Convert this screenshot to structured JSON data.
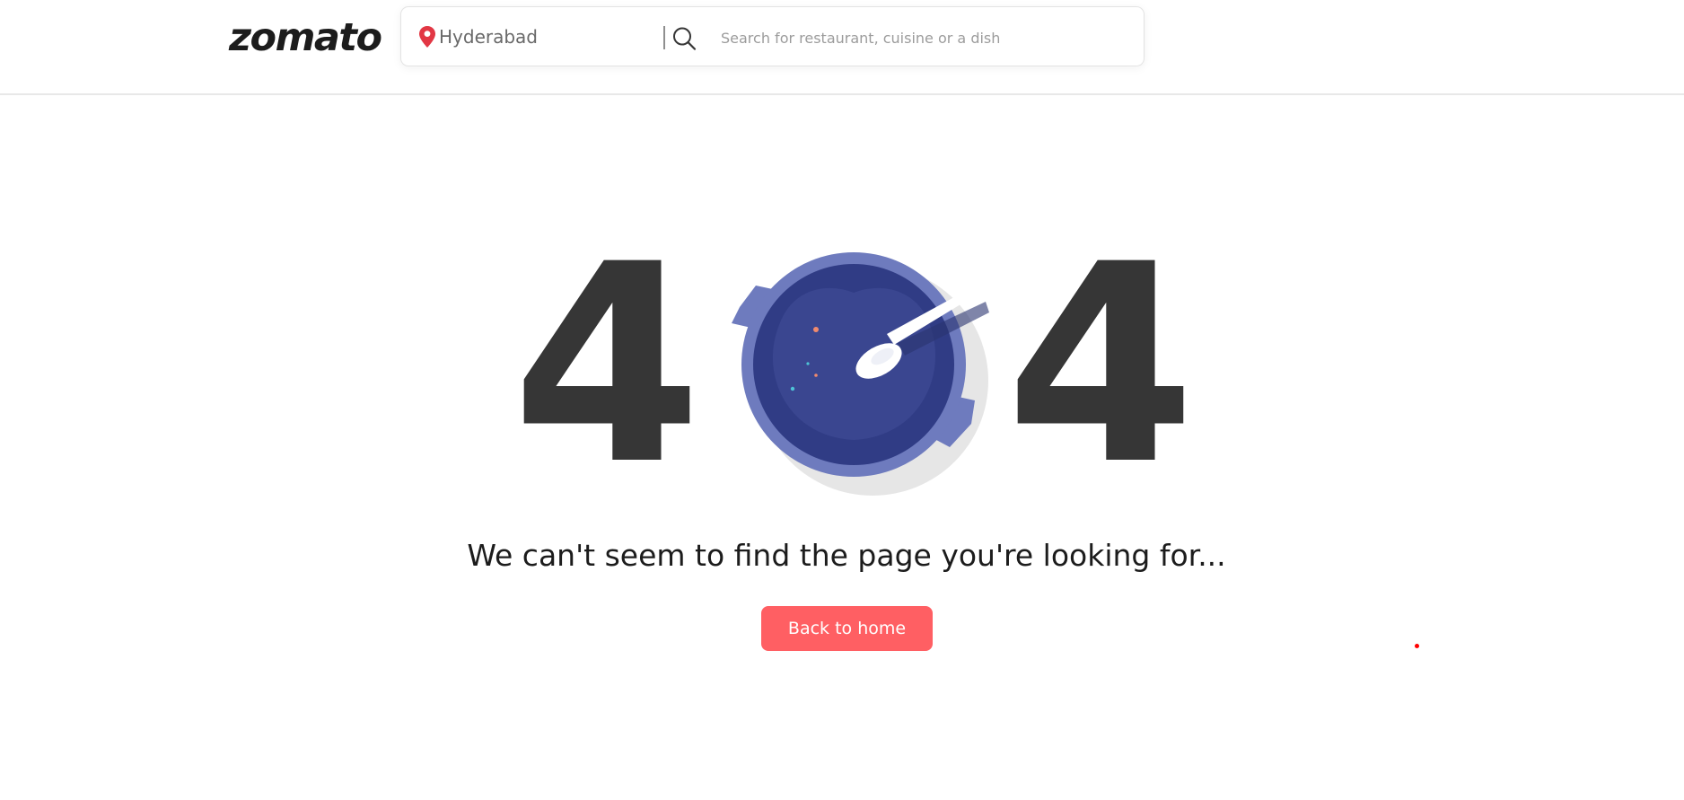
{
  "header": {
    "logo_text": "zomato",
    "search": {
      "location_value": "Hyderabad",
      "location_icon": "location-pin-icon",
      "search_icon": "search-icon",
      "placeholder": "Search for restaurant, cuisine or a dish",
      "value": ""
    }
  },
  "error": {
    "digit_left": "4",
    "digit_right": "4",
    "illustration": "bowl-with-spoon-icon",
    "message": "We can't seem to find the page you're looking for...",
    "back_button_label": "Back to home"
  },
  "colors": {
    "brand_red": "#ff5f63",
    "pin_pink": "#e23744",
    "text_dark": "#363636",
    "bowl_rim": "#6e7bbe",
    "bowl_inner": "#303c85"
  }
}
